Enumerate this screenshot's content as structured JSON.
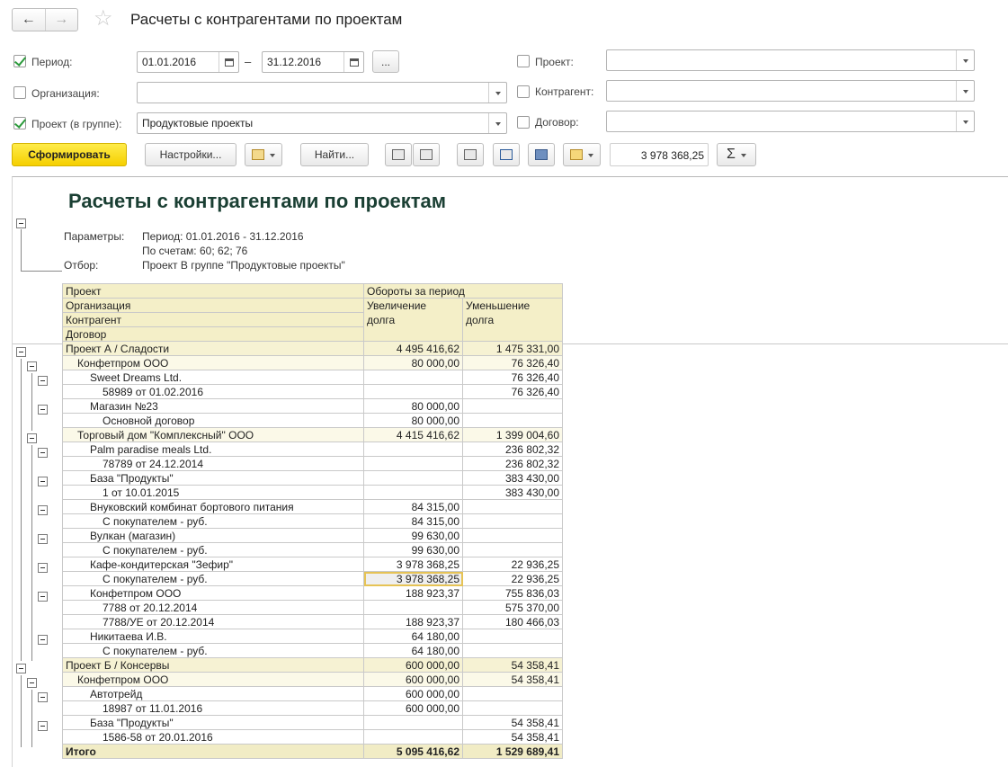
{
  "window": {
    "title": "Расчеты с контрагентами по проектам"
  },
  "filters": {
    "period_label": "Период:",
    "date_from": "01.01.2016",
    "date_to": "31.12.2016",
    "dash": "–",
    "more_label": "...",
    "organization_label": "Организация:",
    "organization_value": "",
    "project_group_label": "Проект (в группе):",
    "project_group_value": "Продуктовые проекты",
    "project_label": "Проект:",
    "counterparty_label": "Контрагент:",
    "contract_label": "Договор:"
  },
  "toolbar": {
    "generate_label": "Сформировать",
    "settings_label": "Настройки...",
    "find_label": "Найти...",
    "sum_value": "3 978 368,25",
    "sum_icon": "Σ"
  },
  "report": {
    "title": "Расчеты с контрагентами по проектам",
    "params_label": "Параметры:",
    "params_line1": "Период: 01.01.2016 - 31.12.2016",
    "params_line2": "По счетам: 60; 62; 76",
    "filter_label": "Отбор:",
    "filter_value": "Проект В группе \"Продуктовые проекты\"",
    "headers": {
      "project": "Проект",
      "turnover": "Обороты за период",
      "organization": "Организация",
      "increase": "Увеличение",
      "decrease": "Уменьшение",
      "counterparty": "Контрагент",
      "debt1": "долга",
      "debt2": "долга",
      "contract": "Договор"
    },
    "rows": [
      {
        "name": "Проект А / Сладости",
        "inc": "4 495 416,62",
        "dec": "1 475 331,00"
      },
      {
        "name": "Конфетпром ООО",
        "inc": "80 000,00",
        "dec": "76 326,40"
      },
      {
        "name": "Sweet Dreams Ltd.",
        "inc": "",
        "dec": "76 326,40"
      },
      {
        "name": "58989 от 01.02.2016",
        "inc": "",
        "dec": "76 326,40"
      },
      {
        "name": "Магазин №23",
        "inc": "80 000,00",
        "dec": ""
      },
      {
        "name": "Основной договор",
        "inc": "80 000,00",
        "dec": ""
      },
      {
        "name": "Торговый дом \"Комплексный\" ООО",
        "inc": "4 415 416,62",
        "dec": "1 399 004,60"
      },
      {
        "name": "Palm paradise meals Ltd.",
        "inc": "",
        "dec": "236 802,32"
      },
      {
        "name": "78789 от 24.12.2014",
        "inc": "",
        "dec": "236 802,32"
      },
      {
        "name": "База \"Продукты\"",
        "inc": "",
        "dec": "383 430,00"
      },
      {
        "name": "1 от 10.01.2015",
        "inc": "",
        "dec": "383 430,00"
      },
      {
        "name": "Внуковский комбинат бортового питания",
        "inc": "84 315,00",
        "dec": ""
      },
      {
        "name": "С покупателем - руб.",
        "inc": "84 315,00",
        "dec": ""
      },
      {
        "name": "Вулкан (магазин)",
        "inc": "99 630,00",
        "dec": ""
      },
      {
        "name": "С покупателем - руб.",
        "inc": "99 630,00",
        "dec": ""
      },
      {
        "name": "Кафе-кондитерская \"Зефир\"",
        "inc": "3 978 368,25",
        "dec": "22 936,25"
      },
      {
        "name": "С покупателем - руб.",
        "inc": "3 978 368,25",
        "dec": "22 936,25"
      },
      {
        "name": "Конфетпром ООО",
        "inc": "188 923,37",
        "dec": "755 836,03"
      },
      {
        "name": "7788 от 20.12.2014",
        "inc": "",
        "dec": "575 370,00"
      },
      {
        "name": "7788/УЕ от 20.12.2014",
        "inc": "188 923,37",
        "dec": "180 466,03"
      },
      {
        "name": "Никитаева И.В.",
        "inc": "64 180,00",
        "dec": ""
      },
      {
        "name": "С покупателем - руб.",
        "inc": "64 180,00",
        "dec": ""
      },
      {
        "name": "Проект Б / Консервы",
        "inc": "600 000,00",
        "dec": "54 358,41"
      },
      {
        "name": "Конфетпром ООО",
        "inc": "600 000,00",
        "dec": "54 358,41"
      },
      {
        "name": "Автотрейд",
        "inc": "600 000,00",
        "dec": ""
      },
      {
        "name": "18987 от 11.01.2016",
        "inc": "600 000,00",
        "dec": ""
      },
      {
        "name": "База \"Продукты\"",
        "inc": "",
        "dec": "54 358,41"
      },
      {
        "name": "1586-58 от 20.01.2016",
        "inc": "",
        "dec": "54 358,41"
      }
    ],
    "total": {
      "name": "Итого",
      "inc": "5 095 416,62",
      "dec": "1 529 689,41"
    }
  }
}
